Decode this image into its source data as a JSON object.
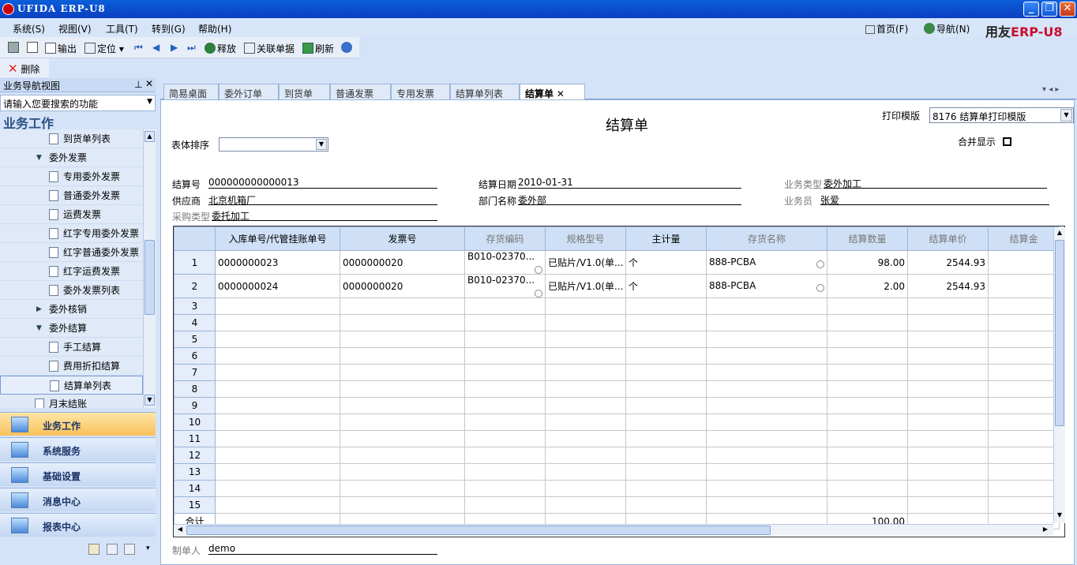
{
  "window": {
    "title": "UFIDA ERP-U8"
  },
  "menu": [
    {
      "label": "系统(S)"
    },
    {
      "label": "视图(V)"
    },
    {
      "label": "工具(T)"
    },
    {
      "label": "转到(G)"
    },
    {
      "label": "帮助(H)"
    }
  ],
  "topnav": {
    "home": "首页(F)",
    "nav": "导航(N)"
  },
  "brand": {
    "main": "用友",
    "erp": "ERP-U8"
  },
  "toolbar": {
    "output": "输出",
    "locate": "定位",
    "release": "释放",
    "linked": "关联单据",
    "refresh": "刷新",
    "delete": "删除"
  },
  "sidebar": {
    "header": "业务导航视图",
    "search_placeholder": "请输入您要搜索的功能",
    "section_title": "业务工作",
    "tree": [
      {
        "label": "到货单列表",
        "type": "leaf"
      },
      {
        "label": "委外发票",
        "type": "open"
      },
      {
        "label": "专用委外发票",
        "type": "leaf"
      },
      {
        "label": "普通委外发票",
        "type": "leaf"
      },
      {
        "label": "运费发票",
        "type": "leaf"
      },
      {
        "label": "红字专用委外发票",
        "type": "leaf"
      },
      {
        "label": "红字普通委外发票",
        "type": "leaf"
      },
      {
        "label": "红字运费发票",
        "type": "leaf"
      },
      {
        "label": "委外发票列表",
        "type": "leaf"
      },
      {
        "label": "委外核销",
        "type": "closed"
      },
      {
        "label": "委外结算",
        "type": "open"
      },
      {
        "label": "手工结算",
        "type": "leaf"
      },
      {
        "label": "费用折扣结算",
        "type": "leaf"
      },
      {
        "label": "结算单列表",
        "type": "leaf",
        "selected": true
      },
      {
        "label": "月末结账",
        "type": "partial"
      }
    ],
    "nav_buttons": [
      {
        "label": "业务工作",
        "active": true
      },
      {
        "label": "系统服务"
      },
      {
        "label": "基础设置"
      },
      {
        "label": "消息中心"
      },
      {
        "label": "报表中心"
      }
    ]
  },
  "tabs": [
    {
      "label": "简易桌面"
    },
    {
      "label": "委外订单"
    },
    {
      "label": "到货单"
    },
    {
      "label": "普通发票"
    },
    {
      "label": "专用发票"
    },
    {
      "label": "结算单列表"
    },
    {
      "label": "结算单",
      "active": true
    }
  ],
  "form": {
    "title": "结算单",
    "print_template_label": "打印模版",
    "print_template_value": "8176 结算单打印模版",
    "sort_label": "表体排序",
    "merge_label": "合并显示",
    "fields": {
      "settle_no_label": "结算号",
      "settle_no": "000000000000013",
      "settle_date_label": "结算日期",
      "settle_date": "2010-01-31",
      "biz_type_label": "业务类型",
      "biz_type": "委外加工",
      "supplier_label": "供应商",
      "supplier": "北京机箱厂",
      "dept_label": "部门名称",
      "dept": "委外部",
      "clerk_label": "业务员",
      "clerk": "张爱",
      "purchase_type_label": "采购类型",
      "purchase_type": "委托加工"
    },
    "maker_label": "制单人",
    "maker": "demo"
  },
  "grid": {
    "headers": [
      "入库单号/代管挂账单号",
      "发票号",
      "存货编码",
      "规格型号",
      "主计量",
      "存货名称",
      "结算数量",
      "结算单价",
      "结算金"
    ],
    "rows": [
      [
        "0000000023",
        "0000000020",
        "B010-02370...",
        "已贴片/V1.0(单...",
        "个",
        "888-PCBA",
        "98.00",
        "2544.93"
      ],
      [
        "0000000024",
        "0000000020",
        "B010-02370...",
        "已贴片/V1.0(单...",
        "个",
        "888-PCBA",
        "2.00",
        "2544.93"
      ]
    ],
    "row_numbers": [
      "1",
      "2",
      "3",
      "4",
      "5",
      "6",
      "7",
      "8",
      "9",
      "10",
      "11",
      "12",
      "13",
      "14",
      "15"
    ],
    "total_label": "合计",
    "total_qty": "100.00"
  }
}
